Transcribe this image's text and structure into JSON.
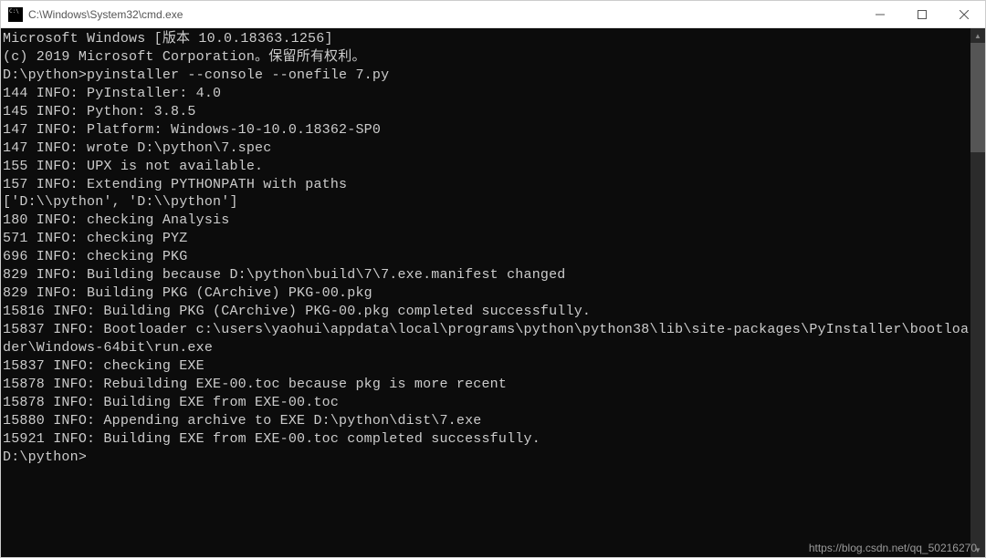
{
  "window": {
    "title": "C:\\Windows\\System32\\cmd.exe"
  },
  "terminal": {
    "lines": [
      "Microsoft Windows [版本 10.0.18363.1256]",
      "(c) 2019 Microsoft Corporation。保留所有权利。",
      "",
      "D:\\python>pyinstaller --console --onefile 7.py",
      "144 INFO: PyInstaller: 4.0",
      "145 INFO: Python: 3.8.5",
      "147 INFO: Platform: Windows-10-10.0.18362-SP0",
      "147 INFO: wrote D:\\python\\7.spec",
      "155 INFO: UPX is not available.",
      "157 INFO: Extending PYTHONPATH with paths",
      "['D:\\\\python', 'D:\\\\python']",
      "180 INFO: checking Analysis",
      "571 INFO: checking PYZ",
      "696 INFO: checking PKG",
      "829 INFO: Building because D:\\python\\build\\7\\7.exe.manifest changed",
      "829 INFO: Building PKG (CArchive) PKG-00.pkg",
      "15816 INFO: Building PKG (CArchive) PKG-00.pkg completed successfully.",
      "15837 INFO: Bootloader c:\\users\\yaohui\\appdata\\local\\programs\\python\\python38\\lib\\site-packages\\PyInstaller\\bootloader\\Windows-64bit\\run.exe",
      "15837 INFO: checking EXE",
      "15878 INFO: Rebuilding EXE-00.toc because pkg is more recent",
      "15878 INFO: Building EXE from EXE-00.toc",
      "15880 INFO: Appending archive to EXE D:\\python\\dist\\7.exe",
      "15921 INFO: Building EXE from EXE-00.toc completed successfully.",
      "",
      "D:\\python>"
    ]
  },
  "watermark": "https://blog.csdn.net/qq_50216270"
}
